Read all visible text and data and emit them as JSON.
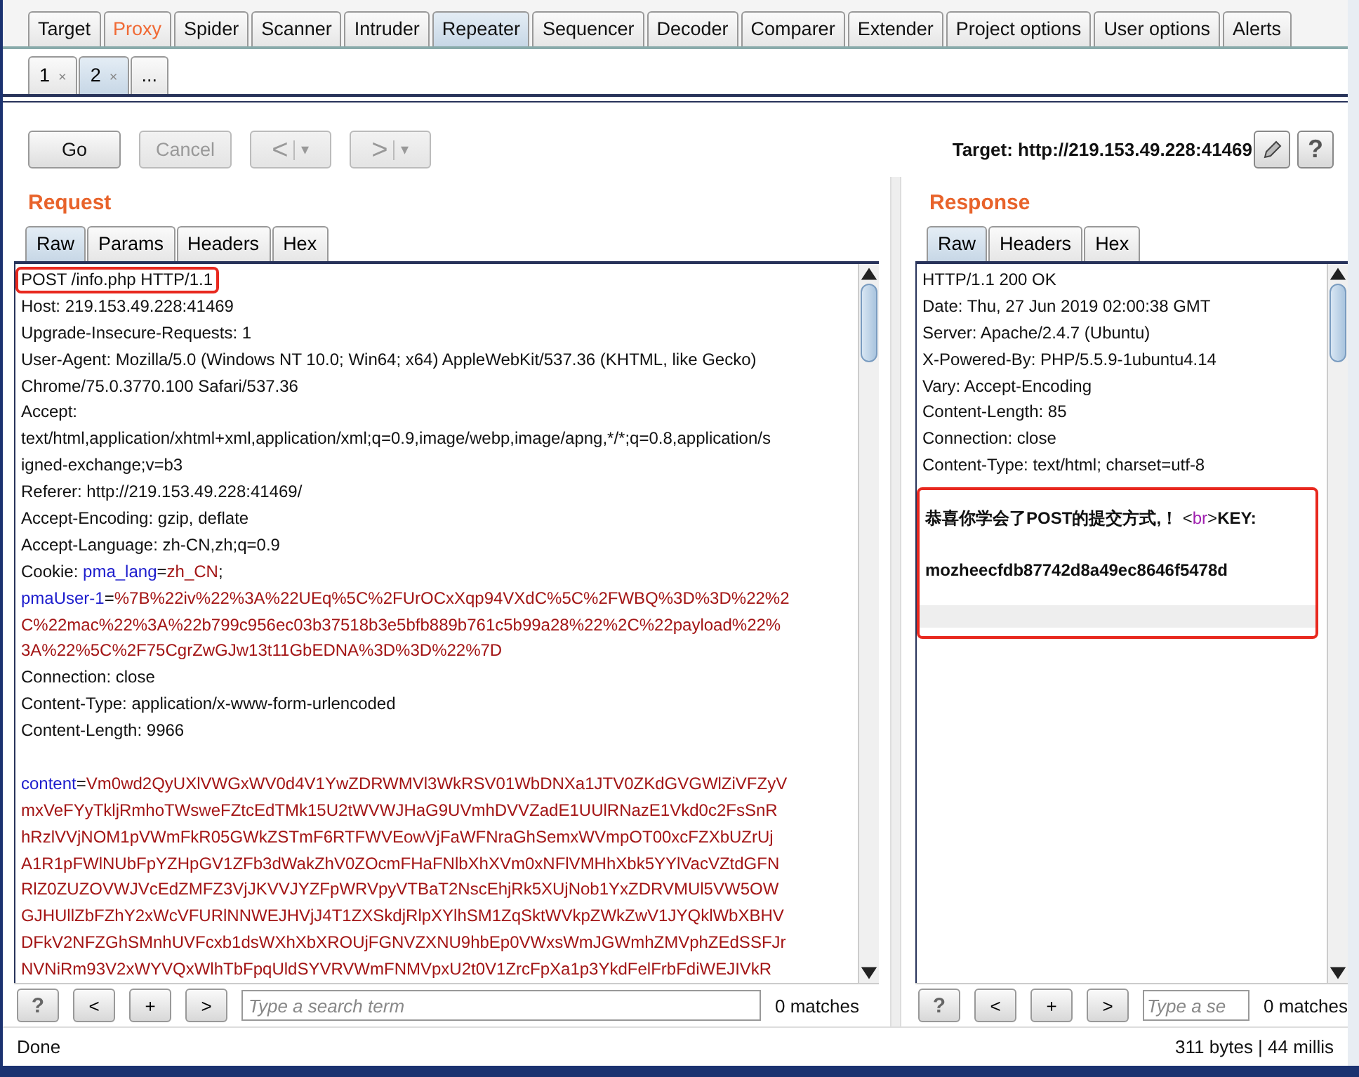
{
  "main_tabs": [
    {
      "label": "Target",
      "selected": false,
      "highlighted": false
    },
    {
      "label": "Proxy",
      "selected": false,
      "highlighted": true
    },
    {
      "label": "Spider",
      "selected": false,
      "highlighted": false
    },
    {
      "label": "Scanner",
      "selected": false,
      "highlighted": false
    },
    {
      "label": "Intruder",
      "selected": false,
      "highlighted": false
    },
    {
      "label": "Repeater",
      "selected": true,
      "highlighted": false
    },
    {
      "label": "Sequencer",
      "selected": false,
      "highlighted": false
    },
    {
      "label": "Decoder",
      "selected": false,
      "highlighted": false
    },
    {
      "label": "Comparer",
      "selected": false,
      "highlighted": false
    },
    {
      "label": "Extender",
      "selected": false,
      "highlighted": false
    },
    {
      "label": "Project options",
      "selected": false,
      "highlighted": false
    },
    {
      "label": "User options",
      "selected": false,
      "highlighted": false
    },
    {
      "label": "Alerts",
      "selected": false,
      "highlighted": false
    }
  ],
  "repeater_tabs": [
    {
      "label": "1",
      "close": "×",
      "selected": false
    },
    {
      "label": "2",
      "close": "×",
      "selected": true
    },
    {
      "label": "...",
      "selected": false
    }
  ],
  "toolbar": {
    "go": {
      "label": "Go",
      "disabled": false
    },
    "cancel": {
      "label": "Cancel",
      "disabled": true
    },
    "back": {
      "label": "<",
      "caret": "▾",
      "disabled": true
    },
    "forward": {
      "label": ">",
      "caret": "▾",
      "disabled": true
    },
    "target": "Target: http://219.153.49.228:41469",
    "help": "?"
  },
  "request": {
    "title": "Request",
    "tabs": [
      {
        "label": "Raw",
        "selected": true
      },
      {
        "label": "Params",
        "selected": false
      },
      {
        "label": "Headers",
        "selected": false
      },
      {
        "label": "Hex",
        "selected": false
      }
    ],
    "lines": [
      {
        "highlighted": true,
        "parts": [
          {
            "kind": "plain",
            "text": "POST /info.php HTTP/1.1"
          }
        ]
      },
      {
        "highlighted": false,
        "parts": [
          {
            "kind": "plain",
            "text": "Host: 219.153.49.228:41469"
          }
        ]
      },
      {
        "highlighted": false,
        "parts": [
          {
            "kind": "plain",
            "text": "Upgrade-Insecure-Requests: 1"
          }
        ]
      },
      {
        "highlighted": false,
        "parts": [
          {
            "kind": "plain",
            "text": "User-Agent: Mozilla/5.0 (Windows NT 10.0; Win64; x64) AppleWebKit/537.36 (KHTML, like Gecko)"
          }
        ]
      },
      {
        "highlighted": false,
        "parts": [
          {
            "kind": "plain",
            "text": "Chrome/75.0.3770.100 Safari/537.36"
          }
        ]
      },
      {
        "highlighted": false,
        "parts": [
          {
            "kind": "plain",
            "text": "Accept:"
          }
        ]
      },
      {
        "highlighted": false,
        "parts": [
          {
            "kind": "plain",
            "text": "text/html,application/xhtml+xml,application/xml;q=0.9,image/webp,image/apng,*/*;q=0.8,application/s"
          }
        ]
      },
      {
        "highlighted": false,
        "parts": [
          {
            "kind": "plain",
            "text": "igned-exchange;v=b3"
          }
        ]
      },
      {
        "highlighted": false,
        "parts": [
          {
            "kind": "plain",
            "text": "Referer: http://219.153.49.228:41469/"
          }
        ]
      },
      {
        "highlighted": false,
        "parts": [
          {
            "kind": "plain",
            "text": "Accept-Encoding: gzip, deflate"
          }
        ]
      },
      {
        "highlighted": false,
        "parts": [
          {
            "kind": "plain",
            "text": "Accept-Language: zh-CN,zh;q=0.9"
          }
        ]
      },
      {
        "highlighted": false,
        "parts": [
          {
            "kind": "plain",
            "text": "Cookie: "
          },
          {
            "kind": "name",
            "text": "pma_lang"
          },
          {
            "kind": "plain",
            "text": "="
          },
          {
            "kind": "value",
            "text": "zh_CN"
          },
          {
            "kind": "plain",
            "text": ";"
          }
        ]
      },
      {
        "highlighted": false,
        "parts": [
          {
            "kind": "name",
            "text": "pmaUser-1"
          },
          {
            "kind": "plain",
            "text": "="
          },
          {
            "kind": "value",
            "text": "%7B%22iv%22%3A%22UEq%5C%2FUrOCxXqp94VXdC%5C%2FWBQ%3D%3D%22%2"
          }
        ]
      },
      {
        "highlighted": false,
        "parts": [
          {
            "kind": "value",
            "text": "C%22mac%22%3A%22b799c956ec03b37518b3e5bfb889b761c5b99a28%22%2C%22payload%22%"
          }
        ]
      },
      {
        "highlighted": false,
        "parts": [
          {
            "kind": "value",
            "text": "3A%22%5C%2F75CgrZwGJw13t11GbEDNA%3D%3D%22%7D"
          }
        ]
      },
      {
        "highlighted": false,
        "parts": [
          {
            "kind": "plain",
            "text": "Connection: close"
          }
        ]
      },
      {
        "highlighted": false,
        "parts": [
          {
            "kind": "plain",
            "text": "Content-Type: application/x-www-form-urlencoded"
          }
        ]
      },
      {
        "highlighted": false,
        "parts": [
          {
            "kind": "plain",
            "text": "Content-Length: 9966"
          }
        ]
      },
      {
        "highlighted": false
      },
      {
        "highlighted": false,
        "parts": [
          {
            "kind": "name",
            "text": "content"
          },
          {
            "kind": "plain",
            "text": "="
          },
          {
            "kind": "value",
            "text": "Vm0wd2QyUXlVWGxWV0d4V1YwZDRWMVl3WkRSV01WbDNXa1JTV0ZKdGVGWlZiVFZyV"
          }
        ]
      },
      {
        "highlighted": false,
        "parts": [
          {
            "kind": "value",
            "text": "mxVeFYyTkljRmhoTWsweFZtcEdTMk15U2tWVWJHaG9UVmhDVVZadE1UUlRNazE1Vkd0c2FsSnR"
          }
        ]
      },
      {
        "highlighted": false,
        "parts": [
          {
            "kind": "value",
            "text": "hRzlVVjNOM1pVWmFkR05GWkZSTmF6RTFWVEowVjFaWFNraGhSemxWVmpOT00xcFZXbUZrUj"
          }
        ]
      },
      {
        "highlighted": false,
        "parts": [
          {
            "kind": "value",
            "text": "A1R1pFWlNUbFpYZHpGV1ZFb3dWakZhV0ZOcmFHaFNlbXhXVm0xNFlVMHhXbk5YYlVacVZtdGFN"
          }
        ]
      },
      {
        "highlighted": false,
        "parts": [
          {
            "kind": "value",
            "text": "RlZ0ZUZOVWJVcEdZMFZ3VjJKVVJYZFpWRVpyVTBaT2NscEhjRk5XUjNob1YxZDRVMUl5VW5OW"
          }
        ]
      },
      {
        "highlighted": false,
        "parts": [
          {
            "kind": "value",
            "text": "GJHUllZbFZhY2xWcVFURlNNWEJHVjJ4T1ZXSkdjRlpXYlhSM1ZqSktWVkpZWkZwV1JYQklWbXBHV"
          }
        ]
      },
      {
        "highlighted": false,
        "parts": [
          {
            "kind": "value",
            "text": "DFkV2NFZGhSMnhUVFcxb1dsWXhXbXROUjFGNVZXNU9hbEp0VWxsWmJGWmhZMVphZEdSSFJr"
          }
        ]
      },
      {
        "highlighted": false,
        "parts": [
          {
            "kind": "value",
            "text": "NVNiRm93V2xWYVQxWlhTbFpqUldSYVRVWmFNMVpxU2t0V1ZrcFpXa1p3YkdFelFrbFdiWEJIVkR"
          }
        ]
      }
    ],
    "search": {
      "buttons": [
        "?",
        "<",
        "+",
        ">"
      ],
      "placeholder": "Type a search term",
      "matches": "0 matches"
    }
  },
  "response": {
    "title": "Response",
    "tabs": [
      {
        "label": "Raw",
        "selected": true
      },
      {
        "label": "Headers",
        "selected": false
      },
      {
        "label": "Hex",
        "selected": false
      }
    ],
    "lines": [
      "HTTP/1.1 200 OK",
      "Date: Thu, 27 Jun 2019 02:00:38 GMT",
      "Server: Apache/2.4.7 (Ubuntu)",
      "X-Powered-By: PHP/5.5.9-1ubuntu4.14",
      "Vary: Accept-Encoding",
      "Content-Length: 85",
      "Connection: close",
      "Content-Type: text/html; charset=utf-8"
    ],
    "body": {
      "highlighted": true,
      "lines": [
        [
          {
            "kind": "bold",
            "text": "恭喜你学会了POST的提交方式,！"
          },
          {
            "kind": "plain",
            "text": " <"
          },
          {
            "kind": "tag",
            "text": "br"
          },
          {
            "kind": "plain",
            "text": ">"
          },
          {
            "kind": "bold",
            "text": "KEY:"
          }
        ],
        [
          {
            "kind": "bold",
            "text": "mozheecfdb87742d8a49ec8646f5478d"
          }
        ]
      ]
    },
    "search": {
      "buttons": [
        "?",
        "<",
        "+",
        ">"
      ],
      "placeholder": "Type a se",
      "matches": "0 matches"
    }
  },
  "status": {
    "left": "Done",
    "right": "311 bytes | 44 millis"
  }
}
